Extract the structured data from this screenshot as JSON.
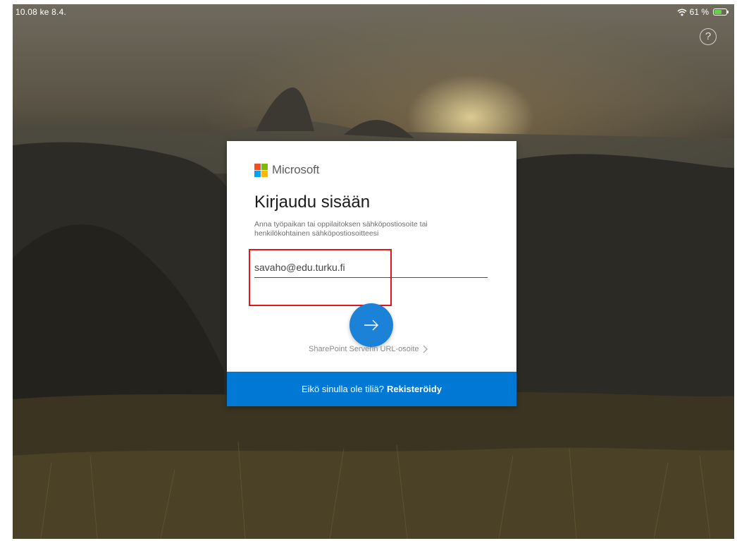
{
  "status_bar": {
    "time_date": "10.08  ke 8.4.",
    "battery_percent": "61 %",
    "battery_level": 0.61
  },
  "help": {
    "glyph": "?"
  },
  "card": {
    "brand_name": "Microsoft",
    "title": "Kirjaudu sisään",
    "subtitle": "Anna työpaikan tai oppilaitoksen sähköpostiosoite tai henkilökohtainen sähköpostiosoitteesi",
    "email_value": "savaho@edu.turku.fi",
    "sharepoint_link": "SharePoint Serverin URL-osoite",
    "footer_text": "Eikö sinulla ole tiliä?",
    "footer_link": "Rekisteröidy"
  },
  "colors": {
    "accent": "#0078d4",
    "next_button": "#1b82d8",
    "highlight": "#e4141c",
    "logo_red": "#f25022",
    "logo_green": "#7fba00",
    "logo_blue": "#00a4ef",
    "logo_yellow": "#ffb900"
  },
  "icons": {
    "status": [
      "wifi-icon",
      "battery-charging-icon"
    ],
    "help": "question-circle-icon",
    "next": "arrow-right-icon",
    "sharepoint": "chevron-right-icon"
  }
}
